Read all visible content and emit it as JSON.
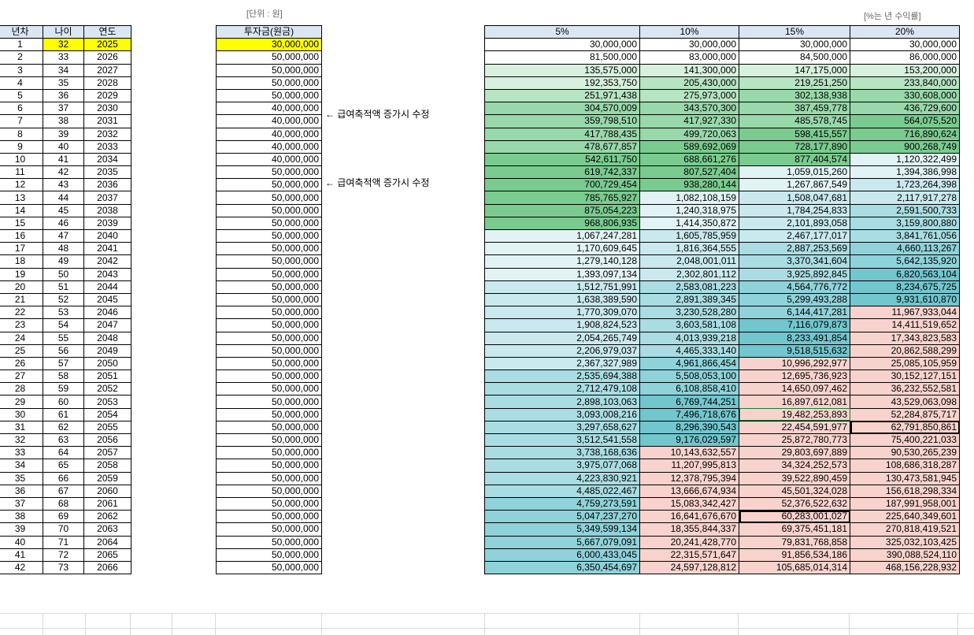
{
  "notes": {
    "unit": "[단위 : 원]",
    "rate_note": "[%는 년 수익률]",
    "edit_note": "← 급여축적액 증가시 수정"
  },
  "left_headers": [
    "년차",
    "나이",
    "연도"
  ],
  "invest_header": "투자금(원금)",
  "rate_headers": [
    "5%",
    "10%",
    "15%",
    "20%"
  ],
  "rows": [
    {
      "n": "1",
      "age": "32",
      "year": "2025",
      "inv": "30,000,000",
      "v": [
        "30,000,000",
        "30,000,000",
        "30,000,000",
        "30,000,000"
      ]
    },
    {
      "n": "2",
      "age": "33",
      "year": "2026",
      "inv": "50,000,000",
      "v": [
        "81,500,000",
        "83,000,000",
        "84,500,000",
        "86,000,000"
      ]
    },
    {
      "n": "3",
      "age": "34",
      "year": "2027",
      "inv": "50,000,000",
      "v": [
        "135,575,000",
        "141,300,000",
        "147,175,000",
        "153,200,000"
      ]
    },
    {
      "n": "4",
      "age": "35",
      "year": "2028",
      "inv": "50,000,000",
      "v": [
        "192,353,750",
        "205,430,000",
        "219,251,250",
        "233,840,000"
      ]
    },
    {
      "n": "5",
      "age": "36",
      "year": "2029",
      "inv": "50,000,000",
      "v": [
        "251,971,438",
        "275,973,000",
        "302,138,938",
        "330,608,000"
      ]
    },
    {
      "n": "6",
      "age": "37",
      "year": "2030",
      "inv": "40,000,000",
      "v": [
        "304,570,009",
        "343,570,300",
        "387,459,778",
        "436,729,600"
      ]
    },
    {
      "n": "7",
      "age": "38",
      "year": "2031",
      "inv": "40,000,000",
      "v": [
        "359,798,510",
        "417,927,330",
        "485,578,745",
        "564,075,520"
      ]
    },
    {
      "n": "8",
      "age": "39",
      "year": "2032",
      "inv": "40,000,000",
      "v": [
        "417,788,435",
        "499,720,063",
        "598,415,557",
        "716,890,624"
      ]
    },
    {
      "n": "9",
      "age": "40",
      "year": "2033",
      "inv": "40,000,000",
      "v": [
        "478,677,857",
        "589,692,069",
        "728,177,890",
        "900,268,749"
      ]
    },
    {
      "n": "10",
      "age": "41",
      "year": "2034",
      "inv": "40,000,000",
      "v": [
        "542,611,750",
        "688,661,276",
        "877,404,574",
        "1,120,322,499"
      ]
    },
    {
      "n": "11",
      "age": "42",
      "year": "2035",
      "inv": "50,000,000",
      "v": [
        "619,742,337",
        "807,527,404",
        "1,059,015,260",
        "1,394,386,998"
      ]
    },
    {
      "n": "12",
      "age": "43",
      "year": "2036",
      "inv": "50,000,000",
      "v": [
        "700,729,454",
        "938,280,144",
        "1,267,867,549",
        "1,723,264,398"
      ]
    },
    {
      "n": "13",
      "age": "44",
      "year": "2037",
      "inv": "50,000,000",
      "v": [
        "785,765,927",
        "1,082,108,159",
        "1,508,047,681",
        "2,117,917,278"
      ]
    },
    {
      "n": "14",
      "age": "45",
      "year": "2038",
      "inv": "50,000,000",
      "v": [
        "875,054,223",
        "1,240,318,975",
        "1,784,254,833",
        "2,591,500,733"
      ]
    },
    {
      "n": "15",
      "age": "46",
      "year": "2039",
      "inv": "50,000,000",
      "v": [
        "968,806,935",
        "1,414,350,872",
        "2,101,893,058",
        "3,159,800,880"
      ]
    },
    {
      "n": "16",
      "age": "47",
      "year": "2040",
      "inv": "50,000,000",
      "v": [
        "1,067,247,281",
        "1,605,785,959",
        "2,467,177,017",
        "3,841,761,056"
      ]
    },
    {
      "n": "17",
      "age": "48",
      "year": "2041",
      "inv": "50,000,000",
      "v": [
        "1,170,609,645",
        "1,816,364,555",
        "2,887,253,569",
        "4,660,113,267"
      ]
    },
    {
      "n": "18",
      "age": "49",
      "year": "2042",
      "inv": "50,000,000",
      "v": [
        "1,279,140,128",
        "2,048,001,011",
        "3,370,341,604",
        "5,642,135,920"
      ]
    },
    {
      "n": "19",
      "age": "50",
      "year": "2043",
      "inv": "50,000,000",
      "v": [
        "1,393,097,134",
        "2,302,801,112",
        "3,925,892,845",
        "6,820,563,104"
      ]
    },
    {
      "n": "20",
      "age": "51",
      "year": "2044",
      "inv": "50,000,000",
      "v": [
        "1,512,751,991",
        "2,583,081,223",
        "4,564,776,772",
        "8,234,675,725"
      ]
    },
    {
      "n": "21",
      "age": "52",
      "year": "2045",
      "inv": "50,000,000",
      "v": [
        "1,638,389,590",
        "2,891,389,345",
        "5,299,493,288",
        "9,931,610,870"
      ]
    },
    {
      "n": "22",
      "age": "53",
      "year": "2046",
      "inv": "50,000,000",
      "v": [
        "1,770,309,070",
        "3,230,528,280",
        "6,144,417,281",
        "11,967,933,044"
      ]
    },
    {
      "n": "23",
      "age": "54",
      "year": "2047",
      "inv": "50,000,000",
      "v": [
        "1,908,824,523",
        "3,603,581,108",
        "7,116,079,873",
        "14,411,519,652"
      ]
    },
    {
      "n": "24",
      "age": "55",
      "year": "2048",
      "inv": "50,000,000",
      "v": [
        "2,054,265,749",
        "4,013,939,218",
        "8,233,491,854",
        "17,343,823,583"
      ]
    },
    {
      "n": "25",
      "age": "56",
      "year": "2049",
      "inv": "50,000,000",
      "v": [
        "2,206,979,037",
        "4,465,333,140",
        "9,518,515,632",
        "20,862,588,299"
      ]
    },
    {
      "n": "26",
      "age": "57",
      "year": "2050",
      "inv": "50,000,000",
      "v": [
        "2,367,327,989",
        "4,961,866,454",
        "10,996,292,977",
        "25,085,105,959"
      ]
    },
    {
      "n": "27",
      "age": "58",
      "year": "2051",
      "inv": "50,000,000",
      "v": [
        "2,535,694,388",
        "5,508,053,100",
        "12,695,736,923",
        "30,152,127,151"
      ]
    },
    {
      "n": "28",
      "age": "59",
      "year": "2052",
      "inv": "50,000,000",
      "v": [
        "2,712,479,108",
        "6,108,858,410",
        "14,650,097,462",
        "36,232,552,581"
      ]
    },
    {
      "n": "29",
      "age": "60",
      "year": "2053",
      "inv": "50,000,000",
      "v": [
        "2,898,103,063",
        "6,769,744,251",
        "16,897,612,081",
        "43,529,063,098"
      ]
    },
    {
      "n": "30",
      "age": "61",
      "year": "2054",
      "inv": "50,000,000",
      "v": [
        "3,093,008,216",
        "7,496,718,676",
        "19,482,253,893",
        "52,284,875,717"
      ]
    },
    {
      "n": "31",
      "age": "62",
      "year": "2055",
      "inv": "50,000,000",
      "v": [
        "3,297,658,627",
        "8,296,390,543",
        "22,454,591,977",
        "62,791,850,861"
      ]
    },
    {
      "n": "32",
      "age": "63",
      "year": "2056",
      "inv": "50,000,000",
      "v": [
        "3,512,541,558",
        "9,176,029,597",
        "25,872,780,773",
        "75,400,221,033"
      ]
    },
    {
      "n": "33",
      "age": "64",
      "year": "2057",
      "inv": "50,000,000",
      "v": [
        "3,738,168,636",
        "10,143,632,557",
        "29,803,697,889",
        "90,530,265,239"
      ]
    },
    {
      "n": "34",
      "age": "65",
      "year": "2058",
      "inv": "50,000,000",
      "v": [
        "3,975,077,068",
        "11,207,995,813",
        "34,324,252,573",
        "108,686,318,287"
      ]
    },
    {
      "n": "35",
      "age": "66",
      "year": "2059",
      "inv": "50,000,000",
      "v": [
        "4,223,830,921",
        "12,378,795,394",
        "39,522,890,459",
        "130,473,581,945"
      ]
    },
    {
      "n": "36",
      "age": "67",
      "year": "2060",
      "inv": "50,000,000",
      "v": [
        "4,485,022,467",
        "13,666,674,934",
        "45,501,324,028",
        "156,618,298,334"
      ]
    },
    {
      "n": "37",
      "age": "68",
      "year": "2061",
      "inv": "50,000,000",
      "v": [
        "4,759,273,591",
        "15,083,342,427",
        "52,376,522,632",
        "187,991,958,001"
      ]
    },
    {
      "n": "38",
      "age": "69",
      "year": "2062",
      "inv": "50,000,000",
      "v": [
        "5,047,237,270",
        "16,641,676,670",
        "60,283,001,027",
        "225,640,349,601"
      ]
    },
    {
      "n": "39",
      "age": "70",
      "year": "2063",
      "inv": "50,000,000",
      "v": [
        "5,349,599,134",
        "18,355,844,337",
        "69,375,451,181",
        "270,818,419,521"
      ]
    },
    {
      "n": "40",
      "age": "71",
      "year": "2064",
      "inv": "50,000,000",
      "v": [
        "5,667,079,091",
        "20,241,428,770",
        "79,831,768,858",
        "325,032,103,425"
      ]
    },
    {
      "n": "41",
      "age": "72",
      "year": "2065",
      "inv": "50,000,000",
      "v": [
        "6,000,433,045",
        "22,315,571,647",
        "91,856,534,186",
        "390,088,524,110"
      ]
    },
    {
      "n": "42",
      "age": "73",
      "year": "2066",
      "inv": "50,000,000",
      "v": [
        "6,350,454,697",
        "24,597,128,812",
        "105,685,014,314",
        "468,156,228,932"
      ]
    }
  ],
  "colors": {
    "header_bg": "#dbe6f5",
    "highlight_yellow": "#ffff00",
    "band_green": [
      "#d8f1de",
      "#b7e4c3",
      "#98d8aa",
      "#7acb8f"
    ],
    "band_teal": [
      "#e2f3f6",
      "#c9e9ee",
      "#a9dde3",
      "#8fd2da",
      "#72c6ce"
    ],
    "band_pink": "#f8d3cd"
  }
}
